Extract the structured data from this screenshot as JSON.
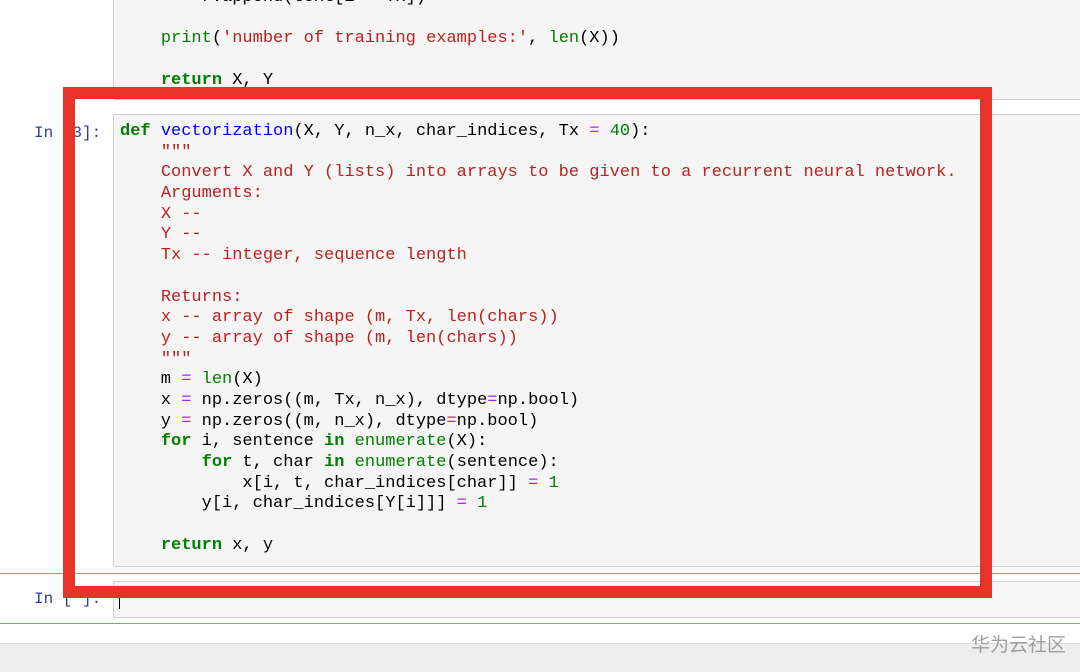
{
  "cells": [
    {
      "prompt": "",
      "lines": [
        [
          [
            "        r.append(text[i ",
            ""
          ],
          [
            "+",
            "o"
          ],
          [
            " Tx])",
            ""
          ]
        ],
        [
          [
            "",
            ""
          ]
        ],
        [
          [
            "    ",
            ""
          ],
          [
            "print",
            "b"
          ],
          [
            "(",
            ""
          ],
          [
            "'number of training examples:'",
            "s"
          ],
          [
            ", ",
            ""
          ],
          [
            "len",
            "b"
          ],
          [
            "(X))",
            ""
          ]
        ],
        [
          [
            "",
            ""
          ]
        ],
        [
          [
            "    ",
            ""
          ],
          [
            "return",
            "k"
          ],
          [
            " X, Y",
            ""
          ]
        ]
      ]
    },
    {
      "prompt": "In [3]:",
      "lines": [
        [
          [
            "def",
            "k"
          ],
          [
            " ",
            ""
          ],
          [
            "vectorization",
            "f"
          ],
          [
            "(X, Y, n_x, char_indices, Tx ",
            ""
          ],
          [
            "=",
            "o"
          ],
          [
            " ",
            ""
          ],
          [
            "40",
            "n"
          ],
          [
            "):",
            ""
          ]
        ],
        [
          [
            "    ",
            ""
          ],
          [
            "\"\"\"",
            "s"
          ]
        ],
        [
          [
            "    ",
            ""
          ],
          [
            "Convert X and Y (lists) into arrays to be given to a recurrent neural network.",
            "s"
          ]
        ],
        [
          [
            "    ",
            ""
          ],
          [
            "Arguments:",
            "s"
          ]
        ],
        [
          [
            "    ",
            ""
          ],
          [
            "X --",
            "s"
          ]
        ],
        [
          [
            "    ",
            ""
          ],
          [
            "Y --",
            "s"
          ]
        ],
        [
          [
            "    ",
            ""
          ],
          [
            "Tx -- integer, sequence length",
            "s"
          ]
        ],
        [
          [
            "",
            ""
          ]
        ],
        [
          [
            "    ",
            ""
          ],
          [
            "Returns:",
            "s"
          ]
        ],
        [
          [
            "    ",
            ""
          ],
          [
            "x -- array of shape (m, Tx, len(chars))",
            "s"
          ]
        ],
        [
          [
            "    ",
            ""
          ],
          [
            "y -- array of shape (m, len(chars))",
            "s"
          ]
        ],
        [
          [
            "    ",
            ""
          ],
          [
            "\"\"\"",
            "s"
          ]
        ],
        [
          [
            "    m ",
            ""
          ],
          [
            "=",
            "o"
          ],
          [
            " ",
            ""
          ],
          [
            "len",
            "b"
          ],
          [
            "(X)",
            ""
          ]
        ],
        [
          [
            "    x ",
            ""
          ],
          [
            "=",
            "o"
          ],
          [
            " np.zeros((m, Tx, n_x), dtype",
            ""
          ],
          [
            "=",
            "o"
          ],
          [
            "np.bool)",
            ""
          ]
        ],
        [
          [
            "    y ",
            ""
          ],
          [
            "=",
            "o"
          ],
          [
            " np.zeros((m, n_x), dtype",
            ""
          ],
          [
            "=",
            "o"
          ],
          [
            "np.bool)",
            ""
          ]
        ],
        [
          [
            "    ",
            ""
          ],
          [
            "for",
            "k"
          ],
          [
            " i, sentence ",
            ""
          ],
          [
            "in",
            "k"
          ],
          [
            " ",
            ""
          ],
          [
            "enumerate",
            "b"
          ],
          [
            "(X):",
            ""
          ]
        ],
        [
          [
            "        ",
            ""
          ],
          [
            "for",
            "k"
          ],
          [
            " t, char ",
            ""
          ],
          [
            "in",
            "k"
          ],
          [
            " ",
            ""
          ],
          [
            "enumerate",
            "b"
          ],
          [
            "(sentence):",
            ""
          ]
        ],
        [
          [
            "            x[i, t, char_indices[char]] ",
            ""
          ],
          [
            "=",
            "o"
          ],
          [
            " ",
            ""
          ],
          [
            "1",
            "n"
          ]
        ],
        [
          [
            "        y[i, char_indices[Y[i]]] ",
            ""
          ],
          [
            "=",
            "o"
          ],
          [
            " ",
            ""
          ],
          [
            "1",
            "n"
          ]
        ],
        [
          [
            "",
            ""
          ]
        ],
        [
          [
            "    ",
            ""
          ],
          [
            "return",
            "k"
          ],
          [
            " x, y",
            ""
          ]
        ]
      ]
    },
    {
      "prompt": "In [ ]:",
      "lines": []
    }
  ],
  "watermark": "华为云社区",
  "colors": {
    "highlight_box": "#e8322a",
    "keyword": "#008000",
    "string": "#ba2121",
    "operator": "#aa22ff",
    "function_name": "#0000ff"
  }
}
